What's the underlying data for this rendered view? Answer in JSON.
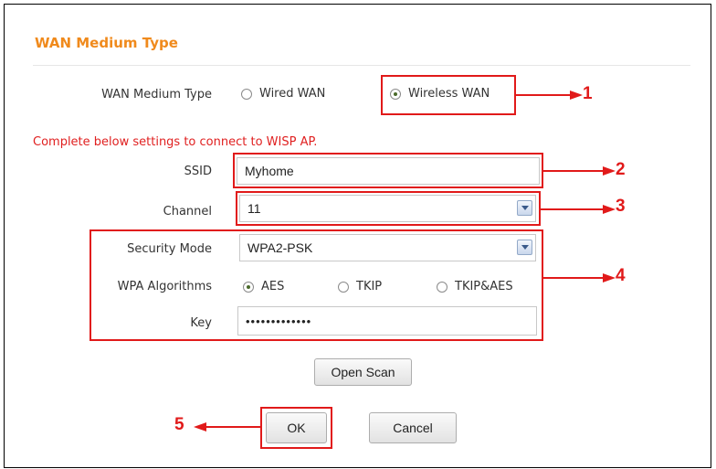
{
  "section": {
    "title": "WAN Medium Type"
  },
  "wan_medium": {
    "label": "WAN Medium Type",
    "options": [
      {
        "label": "Wired WAN",
        "selected": false
      },
      {
        "label": "Wireless WAN",
        "selected": true
      }
    ]
  },
  "notice": "Complete below settings to connect to WISP AP.",
  "ssid": {
    "label": "SSID",
    "value": "Myhome"
  },
  "channel": {
    "label": "Channel",
    "value": "11"
  },
  "security_mode": {
    "label": "Security Mode",
    "value": "WPA2-PSK"
  },
  "wpa_algorithms": {
    "label": "WPA Algorithms",
    "options": [
      {
        "label": "AES",
        "selected": true
      },
      {
        "label": "TKIP",
        "selected": false
      },
      {
        "label": "TKIP&AES",
        "selected": false
      }
    ]
  },
  "key": {
    "label": "Key",
    "value": "•••••••••••••"
  },
  "buttons": {
    "open_scan": "Open Scan",
    "ok": "OK",
    "cancel": "Cancel"
  },
  "callouts": [
    "1",
    "2",
    "3",
    "4",
    "5"
  ],
  "colors": {
    "accent": "#f08a1c",
    "annotation": "#e11a1a",
    "notice": "#e02020"
  }
}
